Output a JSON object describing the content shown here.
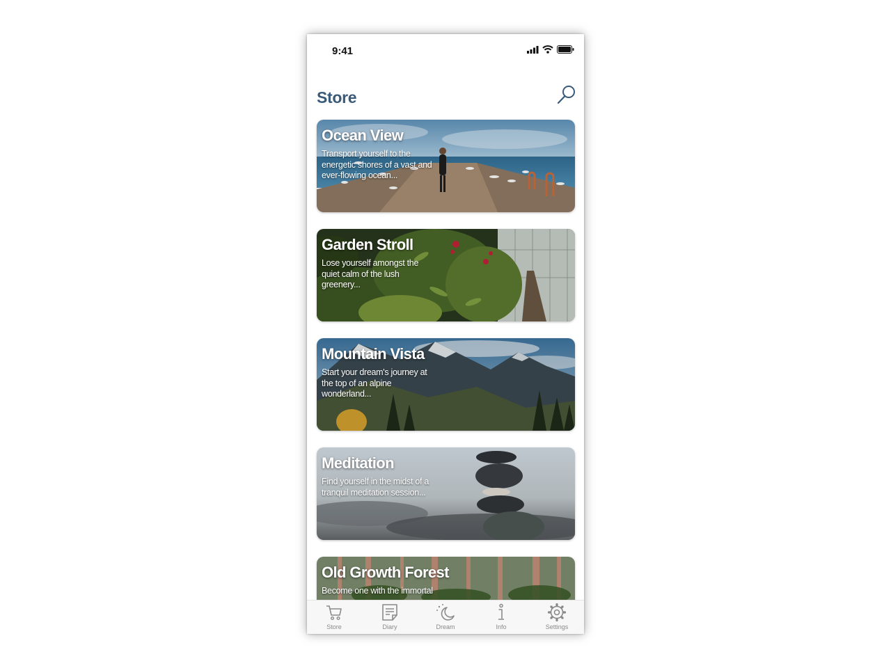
{
  "status_bar": {
    "time": "9:41"
  },
  "header": {
    "title": "Store"
  },
  "cards": [
    {
      "title": "Ocean View",
      "description": "Transport yourself to the energetic shores of a vast and ever-flowing ocean..."
    },
    {
      "title": "Garden Stroll",
      "description": "Lose yourself amongst the quiet calm of the lush greenery..."
    },
    {
      "title": "Mountain Vista",
      "description": "Start your dream's journey at the top of an alpine wonderland..."
    },
    {
      "title": "Meditation",
      "description": "Find yourself in the midst of a tranquil meditation session..."
    },
    {
      "title": "Old Growth Forest",
      "description": "Become one with the immortal"
    }
  ],
  "tabs": [
    {
      "label": "Store",
      "icon": "cart-icon"
    },
    {
      "label": "Diary",
      "icon": "notepad-icon"
    },
    {
      "label": "Dream",
      "icon": "moon-icon"
    },
    {
      "label": "Info",
      "icon": "info-icon"
    },
    {
      "label": "Settings",
      "icon": "gear-icon"
    }
  ],
  "colors": {
    "title": "#3a5a7a",
    "tab_inactive": "#8a8a8a",
    "tab_bar_bg": "#f7f7f7"
  }
}
